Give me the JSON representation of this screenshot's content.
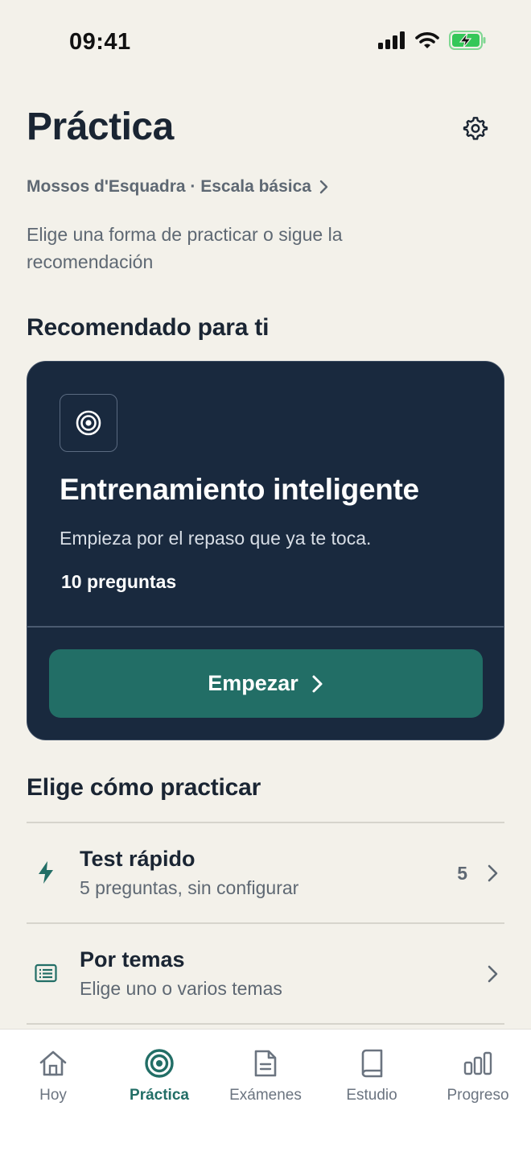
{
  "status_bar": {
    "time": "09:41"
  },
  "header": {
    "title": "Práctica",
    "breadcrumb": "Mossos d'Esquadra · Escala básica",
    "subtitle": "Elige una forma de practicar o sigue la recomendación"
  },
  "recommended": {
    "section_title": "Recomendado para ti",
    "card": {
      "title": "Entrenamiento inteligente",
      "description": "Empieza por el repaso que ya te toca.",
      "count": "10 preguntas",
      "button_label": "Empezar"
    }
  },
  "practice": {
    "section_title": "Elige cómo practicar",
    "options": [
      {
        "title": "Test rápido",
        "subtitle": "5 preguntas, sin configurar",
        "count": "5",
        "icon": "bolt-icon"
      },
      {
        "title": "Por temas",
        "subtitle": "Elige uno o varios temas",
        "count": "",
        "icon": "list-icon"
      }
    ]
  },
  "tab_bar": {
    "tabs": [
      {
        "label": "Hoy",
        "icon": "home-icon"
      },
      {
        "label": "Práctica",
        "icon": "target-icon",
        "active": true
      },
      {
        "label": "Exámenes",
        "icon": "document-icon"
      },
      {
        "label": "Estudio",
        "icon": "book-icon"
      },
      {
        "label": "Progreso",
        "icon": "bar-chart-icon"
      }
    ]
  },
  "colors": {
    "background": "#F3F1EA",
    "card": "#19293E",
    "accent": "#226E66",
    "text_primary": "#1A2533",
    "text_secondary": "#5E6873",
    "battery": "#34C759"
  }
}
